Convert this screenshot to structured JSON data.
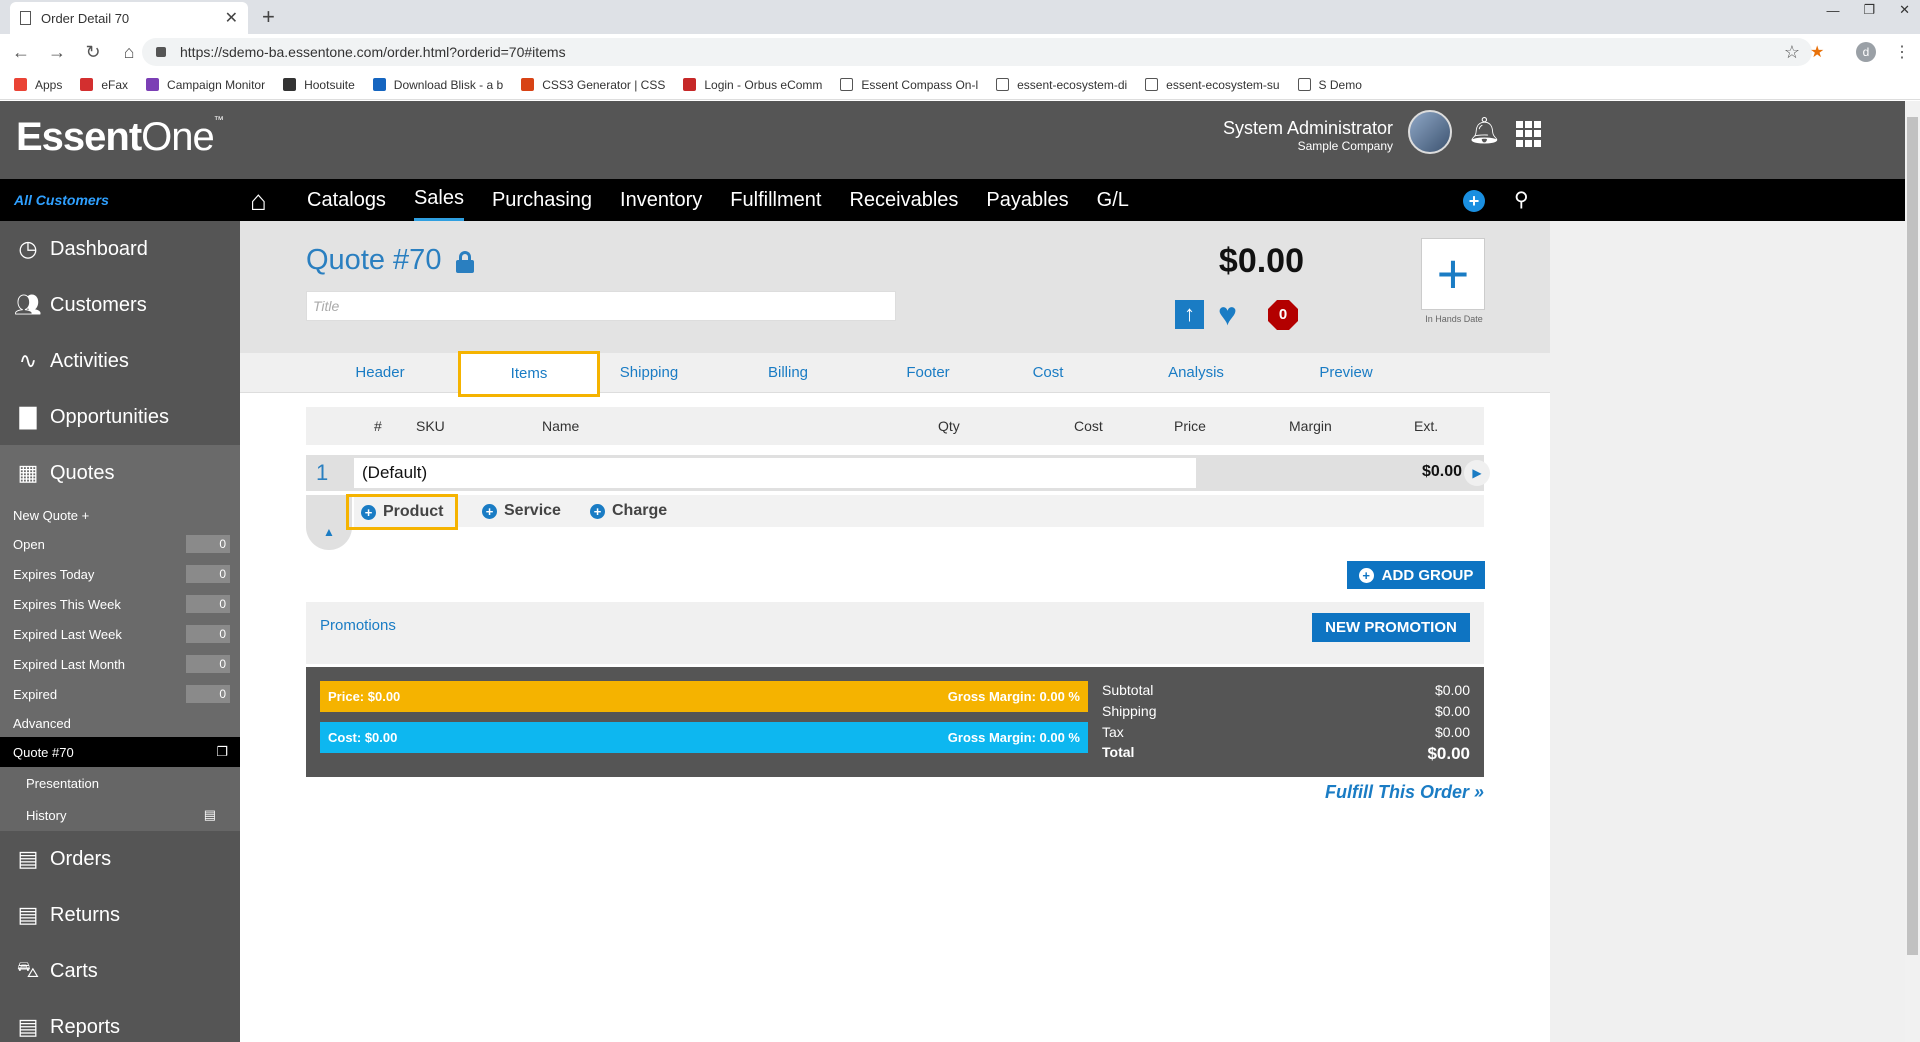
{
  "browser": {
    "tab_title": "Order Detail 70",
    "url": "https://sdemo-ba.essentone.com/order.html?orderid=70#items",
    "bookmarks": [
      "Apps",
      "eFax",
      "Campaign Monitor",
      "Hootsuite",
      "Download Blisk - a b",
      "CSS3 Generator | CSS",
      "Login - Orbus eComm",
      "Essent Compass On-l",
      "essent-ecosystem-di",
      "essent-ecosystem-su",
      "S Demo"
    ],
    "bookmark_colors": [
      "#ea4335",
      "#d32f2f",
      "#7b3fb5",
      "#333333",
      "#1565c0",
      "#d84315",
      "#c62828",
      "#ffffff",
      "#ffffff",
      "#ffffff",
      "#ffffff"
    ],
    "profile_initial": "d"
  },
  "header": {
    "logo_bold": "Essent",
    "logo_light": "One",
    "logo_tm": "™",
    "user_name": "System Administrator",
    "company": "Sample Company"
  },
  "nav": {
    "scope": "All Customers",
    "items": [
      "Catalogs",
      "Sales",
      "Purchasing",
      "Inventory",
      "Fulfillment",
      "Receivables",
      "Payables",
      "G/L"
    ],
    "active": "Sales"
  },
  "sidebar": {
    "main_top": [
      {
        "label": "Dashboard",
        "icon": "clock-icon"
      },
      {
        "label": "Customers",
        "icon": "users-icon"
      },
      {
        "label": "Activities",
        "icon": "pulse-icon"
      },
      {
        "label": "Opportunities",
        "icon": "briefcase-icon"
      },
      {
        "label": "Quotes",
        "icon": "calculator-icon"
      }
    ],
    "new_quote": "New Quote +",
    "quote_filters": [
      {
        "label": "Open",
        "count": "0"
      },
      {
        "label": "Expires Today",
        "count": "0"
      },
      {
        "label": "Expires This Week",
        "count": "0"
      },
      {
        "label": "Expired Last Week",
        "count": "0"
      },
      {
        "label": "Expired Last Month",
        "count": "0"
      },
      {
        "label": "Expired",
        "count": "0"
      }
    ],
    "advanced": "Advanced",
    "current_quote": "Quote #70",
    "quote_children": [
      "Presentation",
      "History"
    ],
    "main_bottom": [
      {
        "label": "Orders",
        "icon": "receipt-icon"
      },
      {
        "label": "Returns",
        "icon": "receipt-icon"
      },
      {
        "label": "Carts",
        "icon": "cart-icon"
      },
      {
        "label": "Reports",
        "icon": "report-icon"
      }
    ]
  },
  "quote": {
    "title": "Quote #70",
    "title_placeholder": "Title",
    "amount": "$0.00",
    "alert_count": "0",
    "in_hands_label": "In Hands Date"
  },
  "tabs": [
    "Header",
    "Items",
    "Shipping",
    "Billing",
    "Footer",
    "Cost",
    "Analysis",
    "Preview"
  ],
  "active_tab": "Items",
  "grid": {
    "columns": [
      "#",
      "SKU",
      "Name",
      "Qty",
      "Cost",
      "Price",
      "Margin",
      "Ext."
    ],
    "group": {
      "number": "1",
      "name": "(Default)",
      "ext": "$0.00"
    },
    "add_buttons": [
      "Product",
      "Service",
      "Charge"
    ]
  },
  "add_group_label": "ADD GROUP",
  "promotions": {
    "label": "Promotions",
    "button": "NEW PROMOTION"
  },
  "summary": {
    "price_label": "Price: $0.00",
    "price_margin": "Gross Margin: 0.00 %",
    "cost_label": "Cost: $0.00",
    "cost_margin": "Gross Margin: 0.00 %",
    "subtotal_label": "Subtotal",
    "subtotal": "$0.00",
    "shipping_label": "Shipping",
    "shipping": "$0.00",
    "tax_label": "Tax",
    "tax": "$0.00",
    "total_label": "Total",
    "total": "$0.00"
  },
  "fulfill_link": "Fulfill This Order »",
  "colors": {
    "accent": "#1a7cc4",
    "highlight": "#f5b300",
    "price_bar": "#f5b300",
    "cost_bar": "#0db7f0",
    "alert": "#b30000"
  }
}
